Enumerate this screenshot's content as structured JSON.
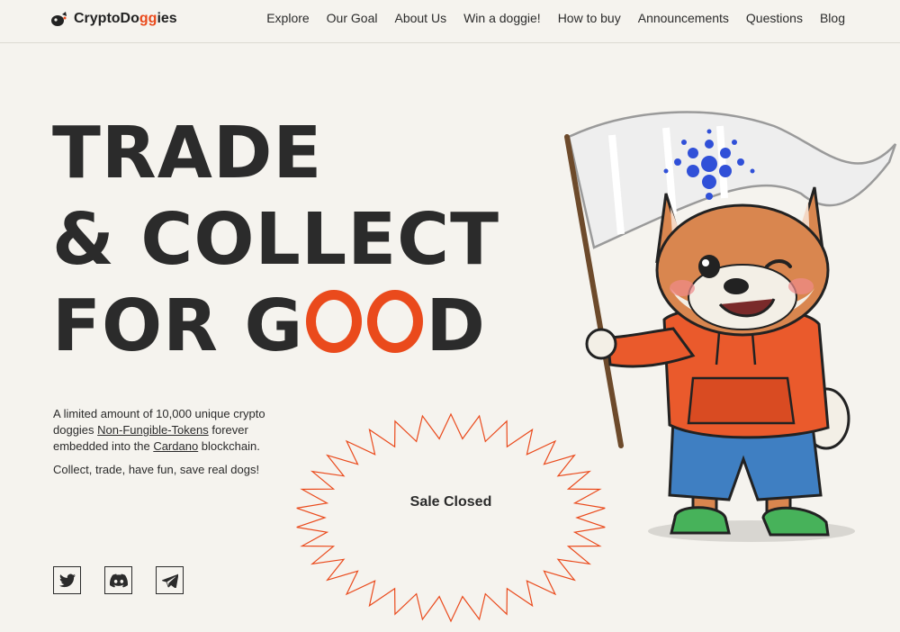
{
  "brand": {
    "prefix": "CryptoDo",
    "accent": "gg",
    "suffix": "ies",
    "accent_color": "#ea4a1c"
  },
  "nav": [
    "Explore",
    "Our Goal",
    "About Us",
    "Win a doggie!",
    "How to buy",
    "Announcements",
    "Questions",
    "Blog"
  ],
  "hero": {
    "line1": "TRADE",
    "line2": "& COLLECT",
    "line3_start": "FOR G",
    "line3_end": "D"
  },
  "description": {
    "text1": "A limited amount of 10,000 unique crypto doggies ",
    "link1": "Non-Fungible-Tokens",
    "text2": " forever embedded into the ",
    "link2": "Cardano",
    "text3": " blockchain.",
    "tagline": "Collect, trade, have fun, save real dogs!"
  },
  "sale": {
    "status": "Sale Closed"
  },
  "social_icons": [
    "twitter-icon",
    "discord-icon",
    "telegram-icon"
  ]
}
